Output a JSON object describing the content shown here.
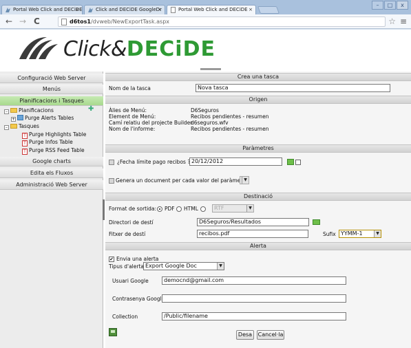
{
  "browser": {
    "tabs": [
      {
        "label": "Portal Web Click and DECiDE"
      },
      {
        "label": "Click and DECiDE GoogleDr"
      },
      {
        "label": "Portal Web Click and DECiDE"
      }
    ],
    "url_host": "d6tos1",
    "url_path": "/dvweb/NewExportTask.aspx"
  },
  "logo": {
    "part1": "Click&",
    "part2": "DECiDE"
  },
  "sidebar": {
    "config_label": "Configuració Web Server",
    "menus_label": "Menús",
    "plans_label": "Planificacions i Tasques",
    "tree": {
      "planificacions": "Planificacions",
      "purge_alerts": "Purge Alerts Tables",
      "tasques": "Tasques",
      "purge_highlights": "Purge Highlights Table",
      "purge_infos": "Purge Infos Table",
      "purge_rss": "Purge RSS Feed Table"
    },
    "google_label": "Google charts",
    "fluxos_label": "Edita els Fluxos",
    "admin_label": "Administració Web Server"
  },
  "form": {
    "create_title": "Crea una tasca",
    "task_name_label": "Nom de la tasca",
    "task_name_value": "Nova tasca",
    "origin_title": "Origen",
    "alias_label": "Àlies de Menú:",
    "alias_value": "D6Seguros",
    "element_label": "Element de Menú:",
    "element_value": "Recibos pendientes - resumen",
    "path_label": "Camí relatiu del projecte Builder:",
    "path_value": "d6seguros.wfv",
    "report_label": "Nom de l'informe:",
    "report_value": "Recibos pendientes - resumen",
    "params_title": "Paràmetres",
    "date_label": "¿Fecha límite pago recibos ?",
    "date_value": "20/12/2012",
    "generate_label": "Genera un document per cada valor del paràmetre:",
    "dest_title": "Destinació",
    "format_label": "Format de sortida:",
    "format_pdf": "PDF",
    "format_html": "HTML",
    "format_rtf": "RTF",
    "dir_label": "Directori de destí",
    "dir_value": "D6Seguros/Resultados",
    "file_label": "Fitxer de destí",
    "file_value": "recibos.pdf",
    "suffix_label": "Sufix",
    "suffix_value": "YYMM-1",
    "alert_title": "Alerta",
    "send_alert_label": "Envia una alerta",
    "alert_type_label": "Tipus d'alerta:",
    "alert_type_value": "Export Google Doc",
    "google_user_label": "Usuari Google",
    "google_user_value": "democnd@gmail.com",
    "google_pass_label": "Contrasenya Google",
    "google_pass_value": "",
    "collection_label": "Collection",
    "collection_value": "/Public/filename",
    "save_label": "Desa",
    "cancel_label": "Cancel·la"
  },
  "colors": {
    "active_menu": "#b6e29e",
    "logo_green": "#2e9a34",
    "chrome_blue": "#a9c1dd"
  }
}
